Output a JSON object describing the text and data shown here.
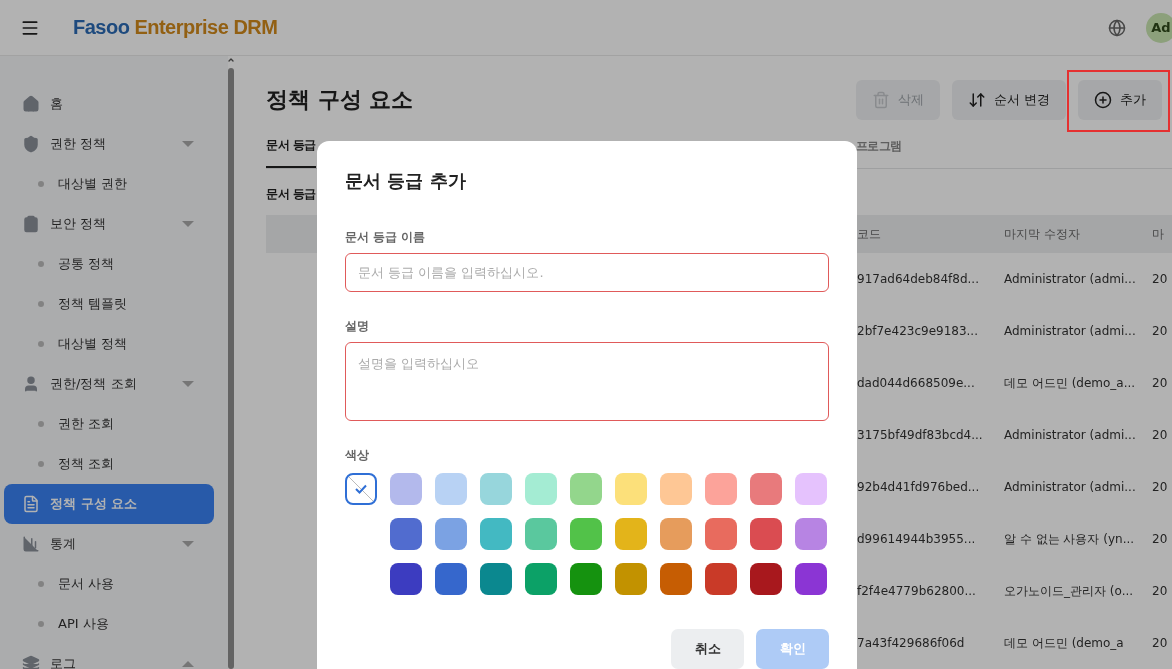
{
  "header": {
    "logo_primary": "Fasoo",
    "logo_secondary": "Enterprise DRM",
    "avatar": "Ad"
  },
  "sidebar": {
    "items": [
      {
        "label": "홈",
        "selected": false
      },
      {
        "label": "권한 정책",
        "selected": false,
        "expanded": true,
        "children": [
          {
            "label": "대상별 권한",
            "selected": false
          }
        ]
      },
      {
        "label": "보안 정책",
        "selected": false,
        "expanded": true,
        "children": [
          {
            "label": "공통 정책",
            "selected": false
          },
          {
            "label": "정책 템플릿",
            "selected": false
          },
          {
            "label": "대상별 정책",
            "selected": false
          }
        ]
      },
      {
        "label": "권한/정책 조회",
        "selected": false,
        "expanded": true,
        "children": [
          {
            "label": "권한 조회",
            "selected": false
          },
          {
            "label": "정책 조회",
            "selected": false
          }
        ]
      },
      {
        "label": "정책 구성 요소",
        "selected": true
      },
      {
        "label": "통계",
        "selected": false,
        "expanded": true,
        "children": [
          {
            "label": "문서 사용",
            "selected": false
          },
          {
            "label": "API 사용",
            "selected": false
          }
        ]
      },
      {
        "label": "로그",
        "selected": false,
        "expanded": false
      }
    ]
  },
  "page": {
    "title": "정책 구성 요소",
    "actions": [
      {
        "label": "삭제",
        "disabled": true,
        "highlighted": false
      },
      {
        "label": "순서 변경",
        "disabled": false,
        "highlighted": false
      },
      {
        "label": "추가",
        "disabled": false,
        "highlighted": true
      }
    ],
    "tabs": [
      {
        "label": "문서 등급",
        "selected": true
      },
      {
        "label": "프로그램",
        "selected": false
      }
    ],
    "section_title": "문서 등급",
    "table": {
      "columns": [
        "코드",
        "마지막 수정자",
        "마"
      ],
      "rows": [
        [
          "917ad64deb84f8d...",
          "Administrator (admi...",
          "20"
        ],
        [
          "2bf7e423c9e9183...",
          "Administrator (admi...",
          "20"
        ],
        [
          "dad044d668509e...",
          "데모 어드민 (demo_a...",
          "20"
        ],
        [
          "3175bf49df83bcd4...",
          "Administrator (admi...",
          "20"
        ],
        [
          "92b4d41fd976bed...",
          "Administrator (admi...",
          "20"
        ],
        [
          "d99614944b3955...",
          "알 수 없는 사용자 (yn...",
          "20"
        ],
        [
          "f2f4e4779b62800...",
          "오가노이드_관리자 (o...",
          "20"
        ],
        [
          "7a43f429686f06d",
          "데모 어드민 (demo_a",
          "20"
        ]
      ]
    }
  },
  "dialog": {
    "title": "문서 등급 추가",
    "name_label": "문서 등급 이름",
    "name_placeholder": "문서 등급 이름을 입력하십시오.",
    "description_label": "설명",
    "description_placeholder": "설명을 입력하십시오",
    "color_label": "색상",
    "swatch_rows": [
      [
        {
          "kind": "none",
          "selected": true
        },
        {
          "kind": "color",
          "color": "#b3b9ec",
          "selected": false
        },
        {
          "kind": "color",
          "color": "#b8d2f4",
          "selected": false
        },
        {
          "kind": "color",
          "color": "#97d6dc",
          "selected": false
        },
        {
          "kind": "color",
          "color": "#a4ecd3",
          "selected": false
        },
        {
          "kind": "color",
          "color": "#93d68c",
          "selected": false
        },
        {
          "kind": "color",
          "color": "#fce07a",
          "selected": false
        },
        {
          "kind": "color",
          "color": "#fec795",
          "selected": false
        },
        {
          "kind": "color",
          "color": "#fca39a",
          "selected": false
        },
        {
          "kind": "color",
          "color": "#e87a7c",
          "selected": false
        },
        {
          "kind": "color",
          "color": "#e5c2fd",
          "selected": false
        }
      ],
      [
        {
          "kind": "color",
          "color": "#516ccf",
          "selected": false
        },
        {
          "kind": "color",
          "color": "#7ba2e3",
          "selected": false
        },
        {
          "kind": "color",
          "color": "#43b9c2",
          "selected": false
        },
        {
          "kind": "color",
          "color": "#5ac89e",
          "selected": false
        },
        {
          "kind": "color",
          "color": "#52c249",
          "selected": false
        },
        {
          "kind": "color",
          "color": "#e3b41a",
          "selected": false
        },
        {
          "kind": "color",
          "color": "#e69c5c",
          "selected": false
        },
        {
          "kind": "color",
          "color": "#e86b5e",
          "selected": false
        },
        {
          "kind": "color",
          "color": "#da4c51",
          "selected": false
        },
        {
          "kind": "color",
          "color": "#b784e3",
          "selected": false
        }
      ],
      [
        {
          "kind": "color",
          "color": "#3c3cc0",
          "selected": false
        },
        {
          "kind": "color",
          "color": "#3667cc",
          "selected": false
        },
        {
          "kind": "color",
          "color": "#0b888f",
          "selected": false
        },
        {
          "kind": "color",
          "color": "#0ca167",
          "selected": false
        },
        {
          "kind": "color",
          "color": "#15920f",
          "selected": false
        },
        {
          "kind": "color",
          "color": "#c29200",
          "selected": false
        },
        {
          "kind": "color",
          "color": "#c65d03",
          "selected": false
        },
        {
          "kind": "color",
          "color": "#c93a28",
          "selected": false
        },
        {
          "kind": "color",
          "color": "#a8181d",
          "selected": false
        },
        {
          "kind": "color",
          "color": "#8b35d4",
          "selected": false
        }
      ]
    ],
    "buttons": [
      {
        "label": "취소",
        "kind": "secondary",
        "disabled": false
      },
      {
        "label": "확인",
        "kind": "primary",
        "disabled": true
      }
    ]
  }
}
